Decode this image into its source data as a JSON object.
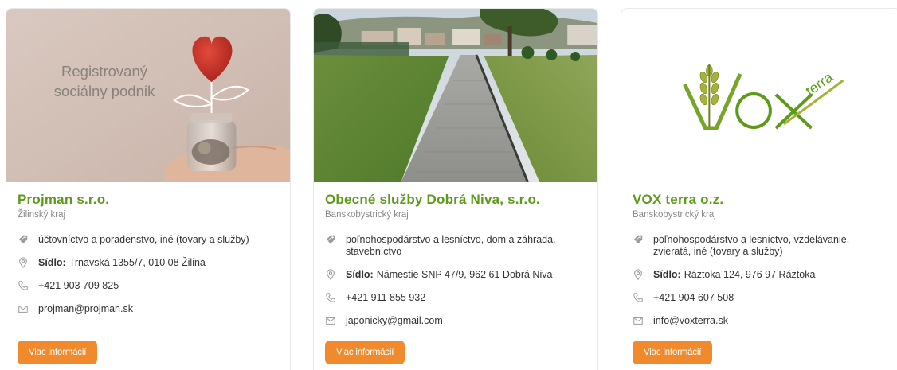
{
  "cards": [
    {
      "title": "Projman s.r.o.",
      "region": "Žilinský kraj",
      "image_text_line1": "Registrovaný",
      "image_text_line2": "sociálny podnik",
      "category": "účtovníctvo a poradenstvo, iné (tovary a služby)",
      "seat_label": "Sídlo:",
      "seat": "Trnavská 1355/7, 010 08 Žilina",
      "phone": "+421 903 709 825",
      "email": "projman@projman.sk",
      "button_label": "Viac informácií"
    },
    {
      "title": "Obecné služby Dobrá Niva, s.r.o.",
      "region": "Banskobystrický kraj",
      "category": "poľnohospodárstvo a lesníctvo, dom a záhrada, stavebníctvo",
      "seat_label": "Sídlo:",
      "seat": "Námestie SNP 47/9, 962 61 Dobrá Niva",
      "phone": "+421 911 855 932",
      "email": "japonicky@gmail.com",
      "button_label": "Viac informácií"
    },
    {
      "title": "VOX terra o.z.",
      "region": "Banskobystrický kraj",
      "logo_text_main": "VOX",
      "logo_text_sub": "terra",
      "category": "poľnohospodárstvo a lesníctvo, vzdelávanie, zvieratá, iné (tovary a služby)",
      "seat_label": "Sídlo:",
      "seat": "Ráztoka 124, 976 97 Ráztoka",
      "phone": "+421 904 607 508",
      "email": "info@voxterra.sk",
      "button_label": "Viac informácií"
    }
  ],
  "colors": {
    "title_green": "#5e9a1a",
    "button_orange": "#f08a2c",
    "icon_gray": "#9a9a9a"
  },
  "icons": [
    "tag-icon",
    "location-pin-icon",
    "phone-icon",
    "envelope-icon"
  ]
}
